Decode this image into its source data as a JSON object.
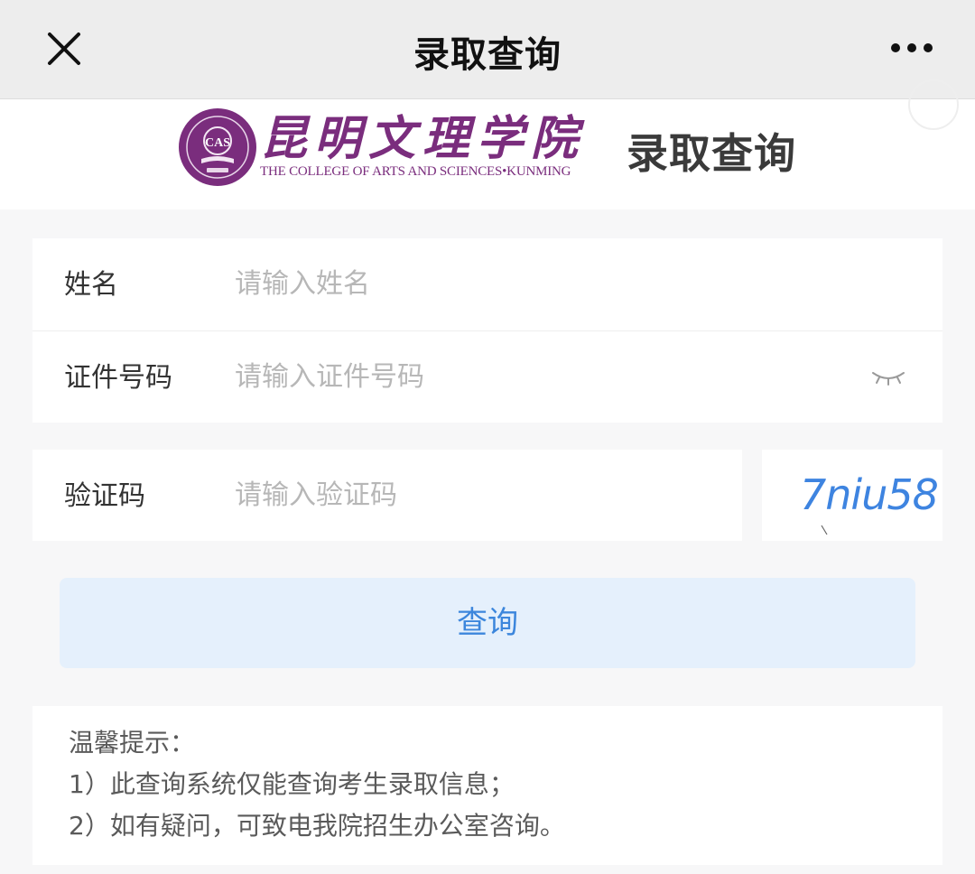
{
  "navbar": {
    "title": "录取查询",
    "close_icon": "close-icon",
    "more_icon": "more-dots-icon"
  },
  "banner": {
    "seal_text": "CAS",
    "college_name_cn": "昆明文理学院",
    "college_name_en": "THE COLLEGE OF ARTS AND SCIENCES•KUNMING",
    "title": "录取查询",
    "brand_color": "#7a2d7d"
  },
  "form": {
    "name_label": "姓名",
    "name_placeholder": "请输入姓名",
    "id_label": "证件号码",
    "id_placeholder": "请输入证件号码",
    "id_toggle_icon": "eye-closed-icon",
    "captcha_label": "验证码",
    "captcha_placeholder": "请输入验证码",
    "captcha_code": "7niu58"
  },
  "query_button": {
    "label": "查询",
    "color": "#3c86dc",
    "background": "#e5f0fc"
  },
  "tips": {
    "title": "温馨提示：",
    "lines": [
      "1）此查询系统仅能查询考生录取信息；",
      "2）如有疑问，可致电我院招生办公室咨询。"
    ]
  }
}
